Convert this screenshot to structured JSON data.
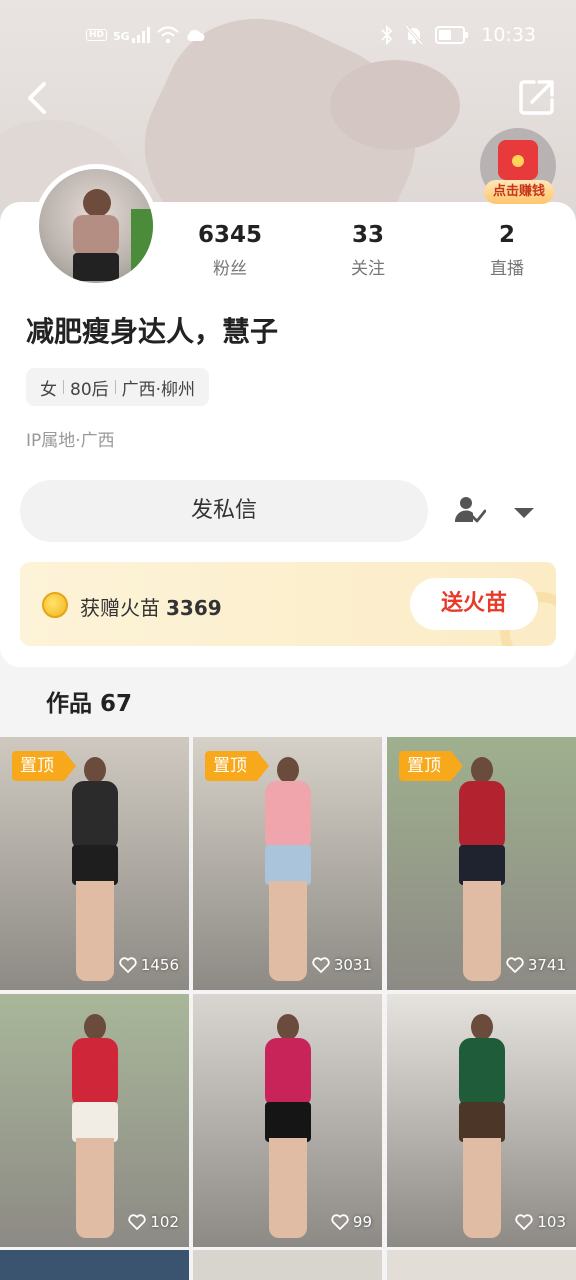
{
  "status_bar": {
    "left_badge": "HD",
    "network": "5G",
    "time": "10:33"
  },
  "header": {
    "back_icon": "chevron-left-icon",
    "share_icon": "share-icon",
    "red_packet_label": "点击赚钱"
  },
  "profile": {
    "stats": [
      {
        "value": "6345",
        "label": "粉丝"
      },
      {
        "value": "33",
        "label": "关注"
      },
      {
        "value": "2",
        "label": "直播"
      }
    ],
    "name": "减肥瘦身达人，慧子",
    "tags": [
      "女",
      "80后",
      "广西·柳州"
    ],
    "ip": "IP属地·广西",
    "message_button": "发私信"
  },
  "gift": {
    "label": "获赠火苗",
    "count": "3369",
    "send_button": "送火苗"
  },
  "works": {
    "title": "作品 67",
    "pin_label": "置顶",
    "items": [
      {
        "likes": "1456",
        "pinned": true,
        "torso": "#2b2b2b",
        "bottom": "#1e1e1e",
        "bg": "#cfc9c0"
      },
      {
        "likes": "3031",
        "pinned": true,
        "torso": "#f0a5ad",
        "bottom": "#aac4dc",
        "bg": "#d6d1c8"
      },
      {
        "likes": "3741",
        "pinned": true,
        "torso": "#b3232f",
        "bottom": "#1f2330",
        "bg": "#9fb08e"
      },
      {
        "likes": "102",
        "pinned": false,
        "torso": "#d0263a",
        "bottom": "#f1ece4",
        "bg": "#a9b79a"
      },
      {
        "likes": "99",
        "pinned": false,
        "torso": "#c9245a",
        "bottom": "#151515",
        "bg": "#d9d6d2"
      },
      {
        "likes": "103",
        "pinned": false,
        "torso": "#1f5c3a",
        "bottom": "#4b3628",
        "bg": "#e6e3de"
      }
    ]
  }
}
